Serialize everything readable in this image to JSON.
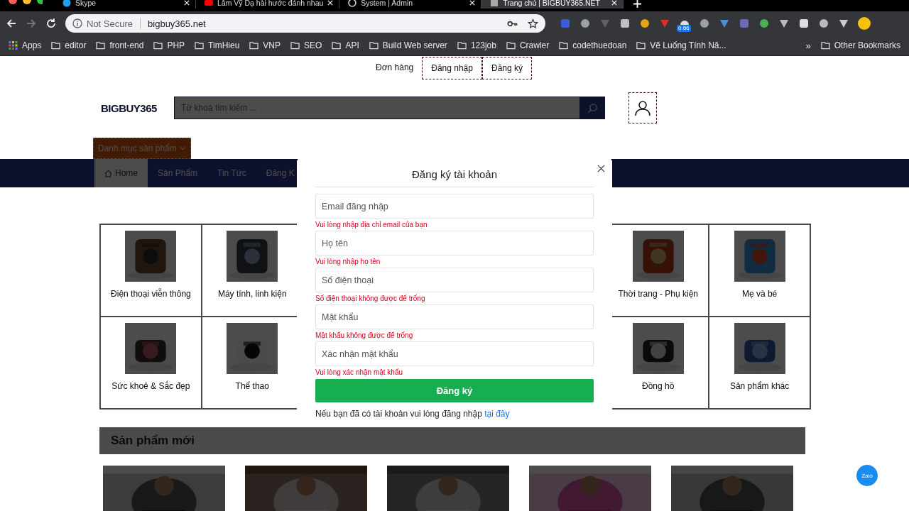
{
  "browser": {
    "tabs": [
      {
        "title": "Skype",
        "selected": false,
        "kind": "skype"
      },
      {
        "title": "Lâm Vỹ Dạ hài hước đánh nhau",
        "selected": false,
        "kind": "video"
      },
      {
        "title": "System | Admin",
        "selected": false,
        "kind": "globe"
      },
      {
        "title": "Trang chủ | BIGBUY365.NET",
        "selected": true,
        "kind": "page"
      }
    ],
    "address_bar": {
      "security": "Not Secure",
      "url": "bigbuy365.net"
    },
    "extension_badge": "0.66",
    "bookmarks": [
      {
        "label": "Apps",
        "kind": "apps"
      },
      {
        "label": "editor",
        "kind": "folder"
      },
      {
        "label": "front-end",
        "kind": "folder"
      },
      {
        "label": "PHP",
        "kind": "folder"
      },
      {
        "label": "TimHieu",
        "kind": "folder"
      },
      {
        "label": "VNP",
        "kind": "folder"
      },
      {
        "label": "SEO",
        "kind": "folder"
      },
      {
        "label": "API",
        "kind": "folder"
      },
      {
        "label": "Build Web server",
        "kind": "folder"
      },
      {
        "label": "123job",
        "kind": "folder"
      },
      {
        "label": "Crawler",
        "kind": "folder"
      },
      {
        "label": "codethuedoan",
        "kind": "folder"
      },
      {
        "label": "Vẽ Luống Tính Nă...",
        "kind": "folder"
      }
    ],
    "bookmarks_overflow": "»",
    "other_bookmarks": "Other Bookmarks"
  },
  "site": {
    "top_links": [
      "Đơn hàng",
      "Đăng nhập",
      "Đăng ký"
    ],
    "logo": "BIGBUY365",
    "search": {
      "placeholder": "Từ khoá tìm kiếm ..."
    },
    "category_button": "Danh mục sản phẩm",
    "nav": [
      {
        "label": "Home",
        "selected": true
      },
      {
        "label": "Sản Phẩm",
        "selected": false
      },
      {
        "label": "Tin Tức",
        "selected": false
      },
      {
        "label": "Đăng K",
        "selected": false
      }
    ],
    "category_rows": [
      [
        "Điện thoại viễn thông",
        "Máy tính, linh kiện",
        "Thời trang - Phụ kiện",
        "Mẹ và bé"
      ],
      [
        "Sức khoẻ & Sắc đẹp",
        "Thể thao",
        "Đồng hồ",
        "Sản phẩm khác"
      ]
    ],
    "section_title": "Sản phẩm mới",
    "products": [
      {
        "kind": "picture"
      },
      {
        "kind": "picture"
      },
      {
        "kind": "picture"
      },
      {
        "kind": "picture"
      },
      {
        "kind": "picture"
      }
    ],
    "chat_button": "Zalo"
  },
  "modal": {
    "title": "Đăng ký tài khoản",
    "fields": [
      {
        "placeholder": "Email đăng nhập",
        "error": "Vui lòng nhập địa chỉ email của bạn"
      },
      {
        "placeholder": "Họ tên",
        "error": "Vui lòng nhập họ tên"
      },
      {
        "placeholder": "Số điện thoại",
        "error": "Số điện thoại không được để trống"
      },
      {
        "placeholder": "Mật khẩu",
        "error": "Mật khẩu không được để trống"
      },
      {
        "placeholder": "Xác nhận mật khẩu",
        "error": "Vui lòng xác nhận mật khẩu"
      }
    ],
    "submit": "Đăng ký",
    "footer_text": "Nếu bạn đã có tài khoản vui lòng đăng nhập",
    "footer_link": "tại đây"
  }
}
